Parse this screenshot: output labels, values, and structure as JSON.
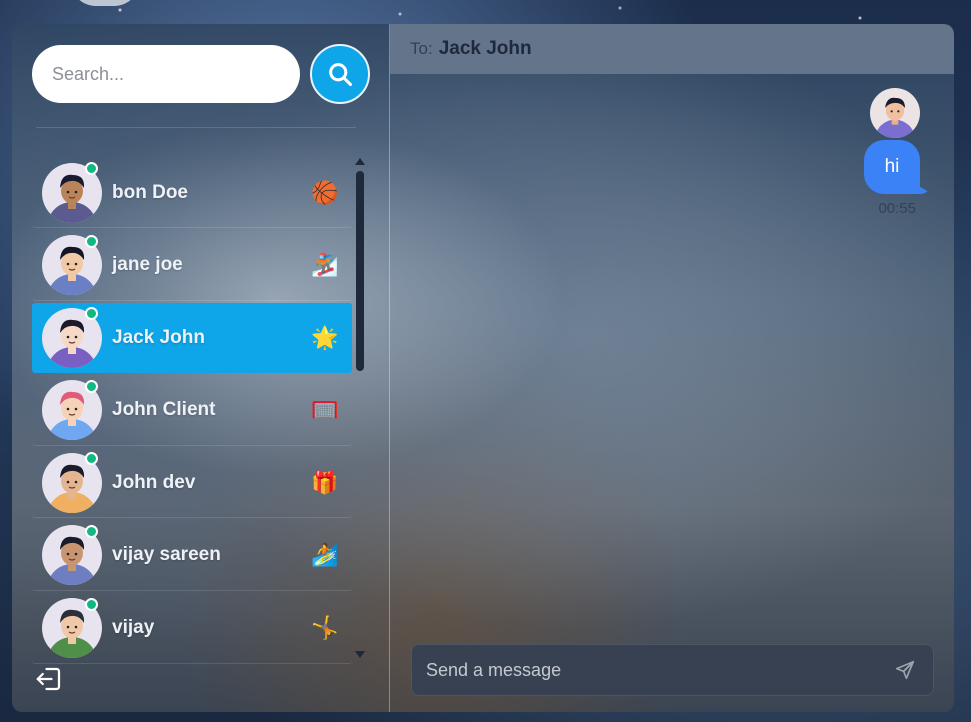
{
  "search": {
    "placeholder": "Search..."
  },
  "contacts": [
    {
      "name": "bon Doe",
      "emoji": "🏀",
      "online": true,
      "active": false,
      "skin": "#b9845a",
      "shirt": "#5b5b8f",
      "hair": "#1b1b2f"
    },
    {
      "name": "jane joe",
      "emoji": "🏂",
      "online": true,
      "active": false,
      "skin": "#f2c9a5",
      "shirt": "#6b7fc4",
      "hair": "#151525"
    },
    {
      "name": "Jack John",
      "emoji": "🌟",
      "online": true,
      "active": true,
      "skin": "#f5d8c6",
      "shirt": "#7a5fc2",
      "hair": "#1a1a2a"
    },
    {
      "name": "John Client",
      "emoji": "🥅",
      "online": true,
      "active": false,
      "skin": "#f6d3b8",
      "shirt": "#6fa8f0",
      "hair": "#e05a7a"
    },
    {
      "name": "John dev",
      "emoji": "🎁",
      "online": true,
      "active": false,
      "skin": "#e5b592",
      "shirt": "#f0b061",
      "hair": "#1b1b2b"
    },
    {
      "name": "vijay sareen",
      "emoji": "🏄",
      "online": true,
      "active": false,
      "skin": "#c99570",
      "shirt": "#6d7fc0",
      "hair": "#1b1b2b"
    },
    {
      "name": "vijay",
      "emoji": "🤸",
      "online": true,
      "active": false,
      "skin": "#f0c8a8",
      "shirt": "#4f8f4a",
      "hair": "#2a2f3a"
    }
  ],
  "chat": {
    "to_label": "To:",
    "to_name": "Jack John",
    "messages": [
      {
        "text": "hi",
        "time": "00:55"
      }
    ],
    "composer_placeholder": "Send a message"
  },
  "colors": {
    "accent": "#0ea5e9",
    "bubble": "#3b82f6",
    "online": "#10b981",
    "header": "#64748b"
  }
}
